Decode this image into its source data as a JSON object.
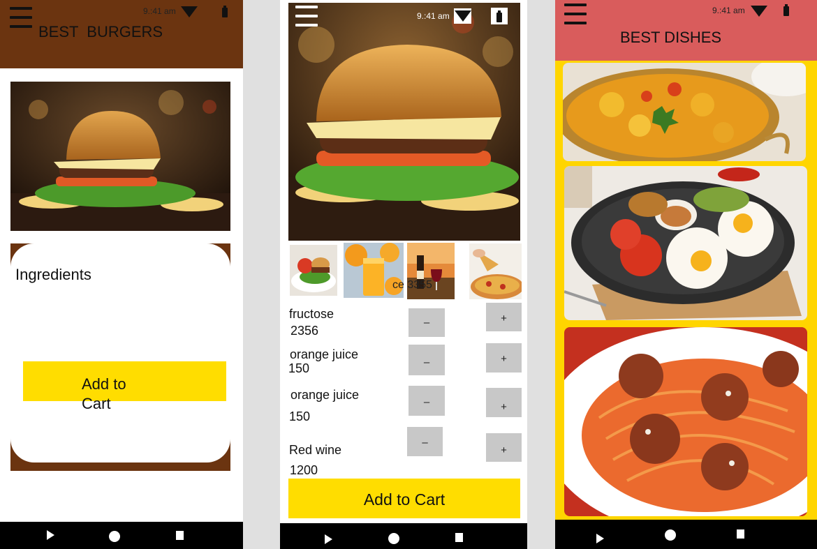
{
  "screen1": {
    "status_time": "9.:41 am",
    "title": "BEST  BURGERS",
    "ingredients_heading": "Ingredients",
    "add_to_cart_line1": "Add to",
    "add_to_cart_line2": "Cart",
    "header_color": "#6b3410",
    "button_color": "#ffdd00"
  },
  "screen2": {
    "status_time": "9.:41 am",
    "thumb_overlay_text": "ce 3355",
    "items": [
      {
        "name": "fructose",
        "value": "2356"
      },
      {
        "name": "orange juice",
        "value": "150"
      },
      {
        "name": "orange juice",
        "value": "150"
      },
      {
        "name": "Red wine",
        "value": "1200"
      }
    ],
    "minus_label": "–",
    "plus_label": "+",
    "add_to_cart": "Add to Cart"
  },
  "screen3": {
    "status_time": "9.:41 am",
    "title": "BEST DISHES",
    "header_color": "#d95c5c",
    "background_color": "#ffd500"
  },
  "icons": [
    "menu-icon",
    "wifi-icon",
    "battery-icon",
    "back-icon",
    "home-icon",
    "recent-apps-icon",
    "minus-icon",
    "plus-icon"
  ]
}
